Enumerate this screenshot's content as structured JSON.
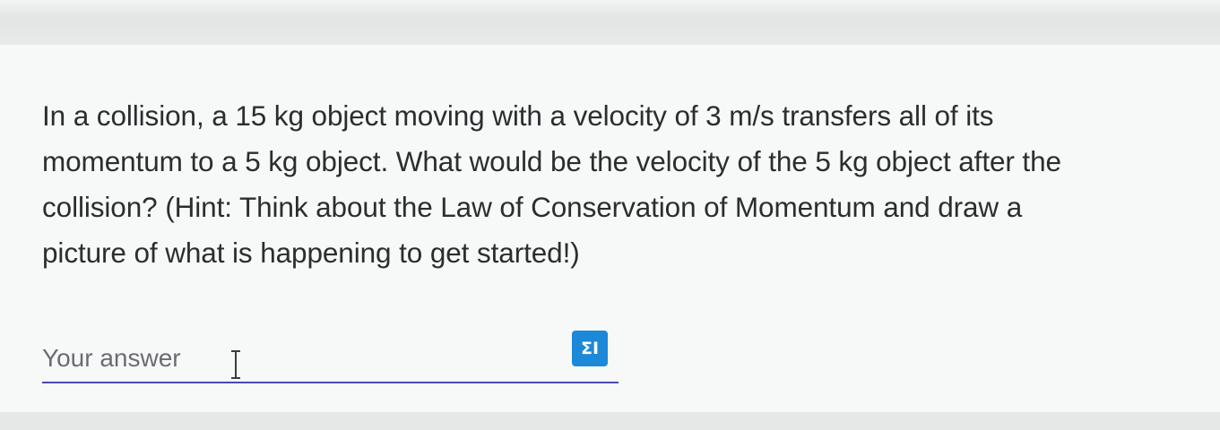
{
  "question": {
    "line1": "In a collision, a 15 kg object moving with a velocity of 3 m/s transfers all of its",
    "line2": "momentum to a 5 kg object. What would be the velocity of the 5 kg object after the",
    "line3": "collision? (Hint: Think about the Law of Conservation of Momentum and draw a",
    "line4": "picture of what is happening to get started!)"
  },
  "answer": {
    "placeholder": "Your answer",
    "value": ""
  },
  "equation_button": {
    "icon": "sigma-i",
    "label": "ΣI"
  },
  "colors": {
    "underline": "#4a49b0",
    "button": "#1c88d8",
    "text": "#2b2d2f"
  }
}
